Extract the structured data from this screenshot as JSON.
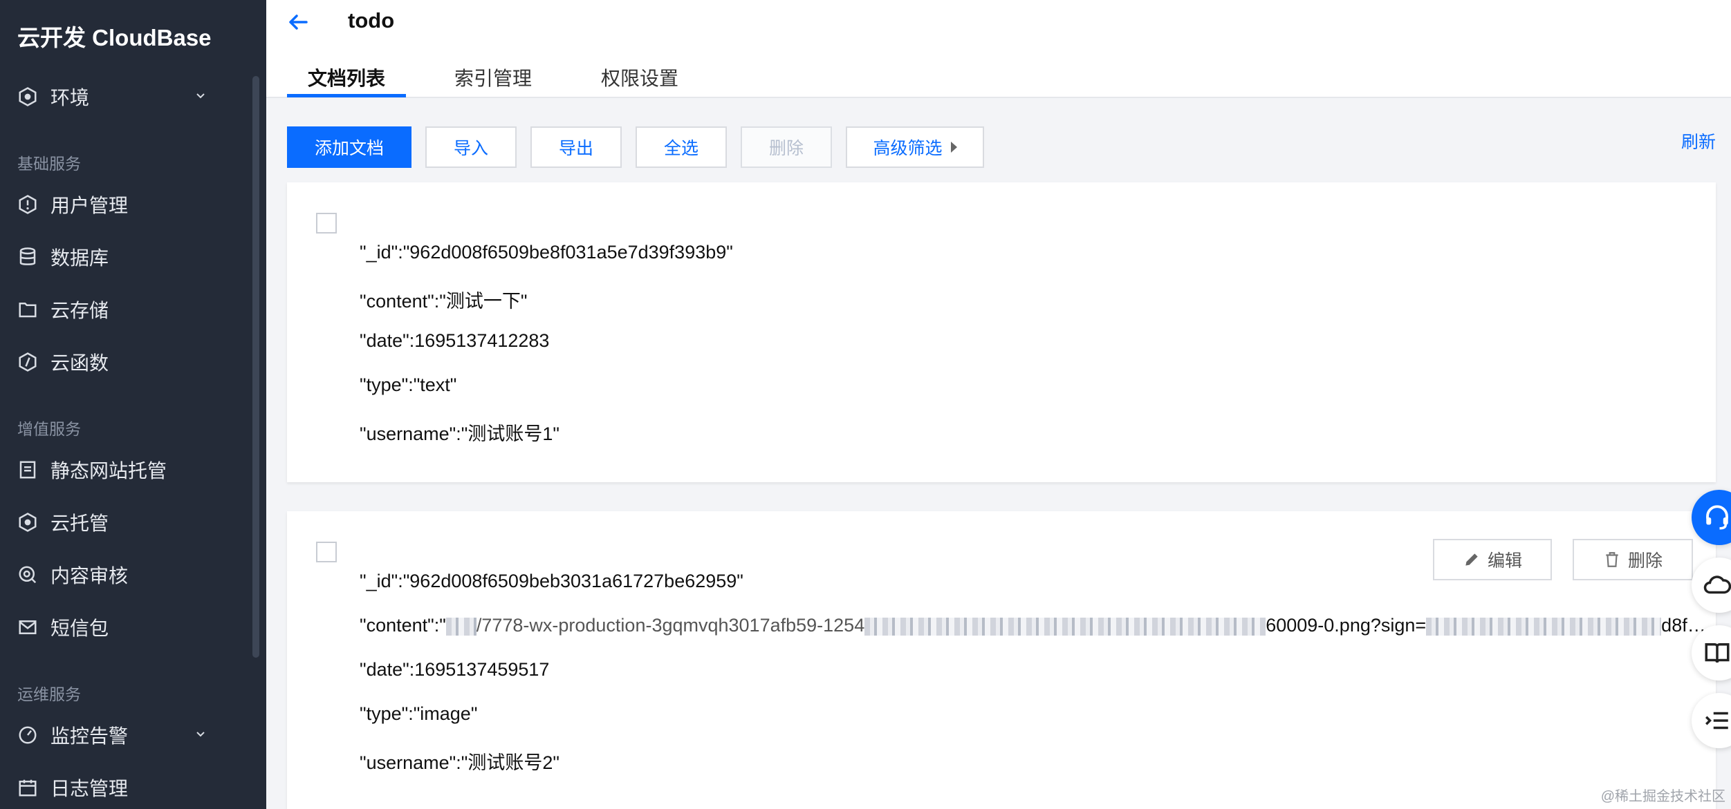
{
  "sidebar": {
    "brand": "云开发 CloudBase",
    "env": "环境",
    "group_basic": "基础服务",
    "items_basic": [
      "用户管理",
      "数据库",
      "云存储",
      "云函数"
    ],
    "group_value": "增值服务",
    "items_value": [
      "静态网站托管",
      "云托管",
      "内容审核",
      "短信包"
    ],
    "group_ops": "运维服务",
    "items_ops": [
      "监控告警",
      "日志管理"
    ]
  },
  "header": {
    "title": "todo",
    "tabs": [
      "文档列表",
      "索引管理",
      "权限设置"
    ]
  },
  "toolbar": {
    "add": "添加文档",
    "import": "导入",
    "export": "导出",
    "select_all": "全选",
    "delete": "删除",
    "advanced": "高级筛选",
    "refresh": "刷新"
  },
  "docs": [
    {
      "id": "\"_id\":\"962d008f6509be8f031a5e7d39f393b9\"",
      "content": "\"content\":\"测试一下\"",
      "date": "\"date\":1695137412283",
      "type": "\"type\":\"text\"",
      "username": "\"username\":\"测试账号1\""
    },
    {
      "id": "\"_id\":\"962d008f6509beb3031a61727be62959\"",
      "content_prefix": "\"content\":\"",
      "content_mid": "/7778-wx-production-3gqmvqh3017afb59-1254",
      "content_suffix": "60009-0.png?sign=",
      "content_tail": "d8f…",
      "date": "\"date\":1695137459517",
      "type": "\"type\":\"image\"",
      "username": "\"username\":\"测试账号2\"",
      "edit": "编辑",
      "delete": "删除"
    }
  ],
  "watermark": "@稀土掘金技术社区"
}
